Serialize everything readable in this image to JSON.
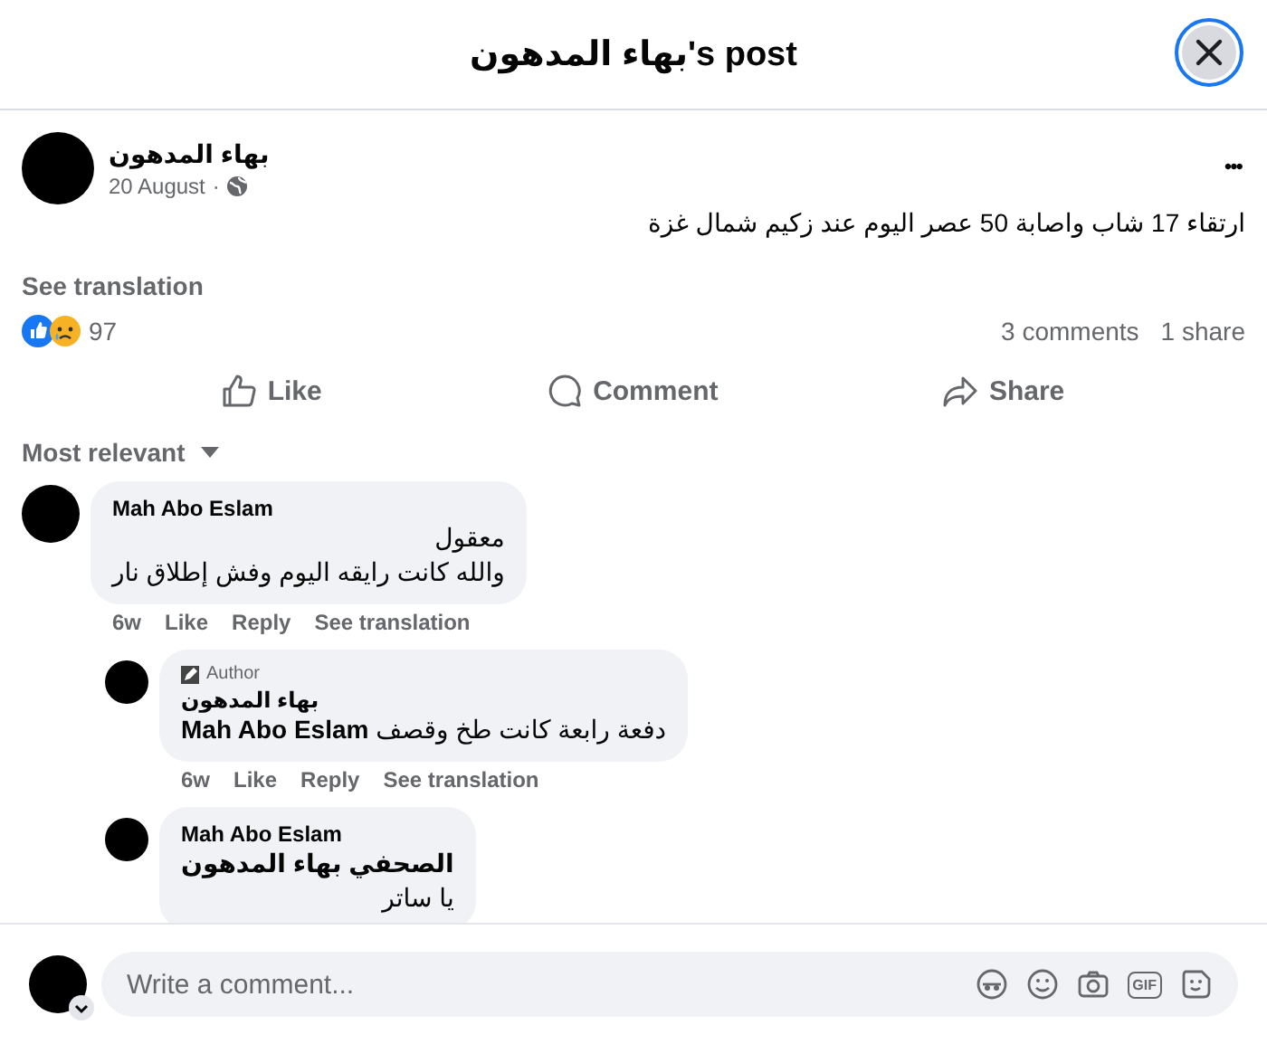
{
  "dialog": {
    "title": "بهاء المدهون's post"
  },
  "post": {
    "author": "بهاء المدهون",
    "date": "20 August",
    "separator": "·",
    "more": "•••",
    "text": "ارتقاء 17 شاب واصابة 50 عصر اليوم عند زكيم شمال غزة",
    "see_translation": "See translation",
    "reaction_count": "97",
    "comments_count": "3 comments",
    "shares_count": "1 share"
  },
  "actions": [
    {
      "kind": "like",
      "label": "Like"
    },
    {
      "kind": "comment",
      "label": "Comment"
    },
    {
      "kind": "share",
      "label": "Share"
    }
  ],
  "sort": {
    "label": "Most relevant"
  },
  "comments": [
    {
      "name": "Mah Abo Eslam",
      "author_badge": false,
      "lines": [
        "معقول",
        "والله كانت رايقه اليوم وفش إطلاق نار"
      ],
      "time": "6w",
      "like": "Like",
      "reply": "Reply",
      "translate": "See translation",
      "children": [
        {
          "name": "بهاء المدهون",
          "author_badge": true,
          "badge_label": "Author",
          "lines": [
            "**Mah Abo Eslam** دفعة رابعة كانت طخ وقصف"
          ],
          "time": "6w",
          "like": "Like",
          "reply": "Reply",
          "translate": "See translation"
        },
        {
          "name": "Mah Abo Eslam",
          "author_badge": false,
          "lines": [
            "**الصحفي بهاء المدهون**",
            "يا ساتر"
          ]
        }
      ]
    }
  ],
  "composer": {
    "placeholder": "Write a comment...",
    "gif_label": "GIF"
  }
}
